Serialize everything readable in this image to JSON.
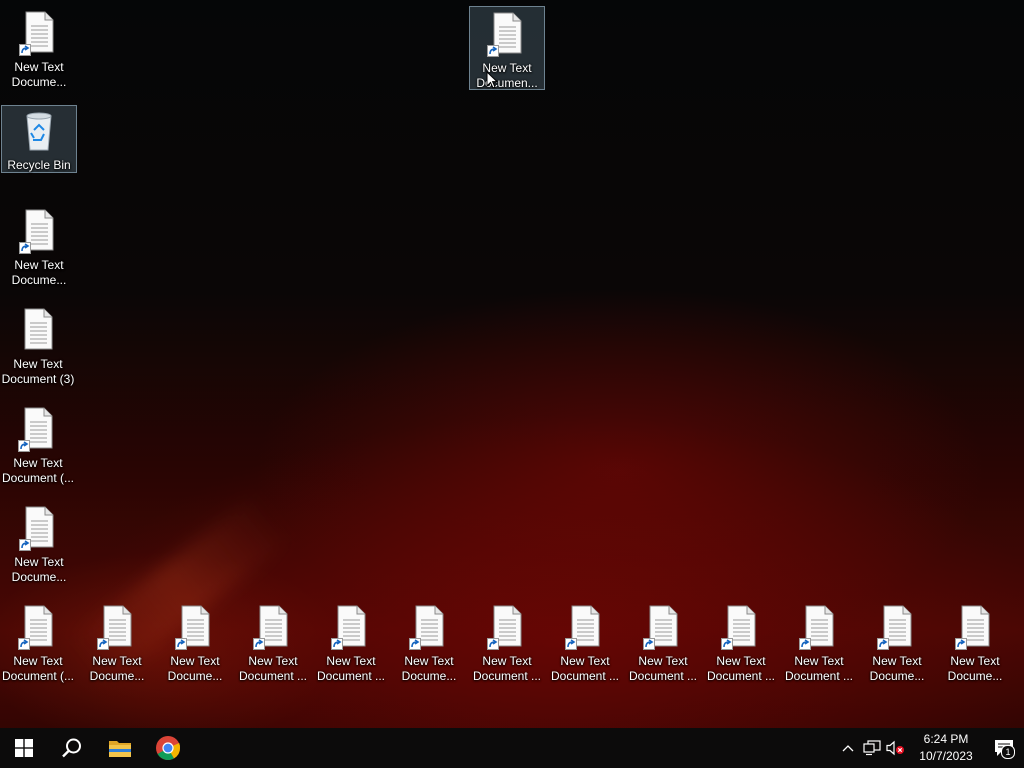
{
  "desktop": {
    "icons": [
      {
        "label": "New Text\nDocume...",
        "type": "text-document-shortcut",
        "selected": false
      },
      {
        "label": "Recycle Bin",
        "type": "recycle-bin",
        "selected": true
      },
      {
        "label": "New Text\nDocume...",
        "type": "text-document-shortcut",
        "selected": false
      },
      {
        "label": "New Text\nDocument (3)",
        "type": "text-document",
        "selected": false
      },
      {
        "label": "New Text\nDocument (...",
        "type": "text-document-shortcut",
        "selected": false
      },
      {
        "label": "New Text\nDocume...",
        "type": "text-document-shortcut",
        "selected": false
      },
      {
        "label": "New Text\nDocumen...",
        "type": "text-document-shortcut",
        "selected": true
      },
      {
        "label": "New Text\nDocument (...",
        "type": "text-document-shortcut",
        "selected": false
      },
      {
        "label": "New Text\nDocume...",
        "type": "text-document-shortcut",
        "selected": false
      },
      {
        "label": "New Text\nDocume...",
        "type": "text-document-shortcut",
        "selected": false
      },
      {
        "label": "New Text\nDocument ...",
        "type": "text-document-shortcut",
        "selected": false
      },
      {
        "label": "New Text\nDocument ...",
        "type": "text-document-shortcut",
        "selected": false
      },
      {
        "label": "New Text\nDocume...",
        "type": "text-document-shortcut",
        "selected": false
      },
      {
        "label": "New Text\nDocument ...",
        "type": "text-document-shortcut",
        "selected": false
      },
      {
        "label": "New Text\nDocument ...",
        "type": "text-document-shortcut",
        "selected": false
      },
      {
        "label": "New Text\nDocument ...",
        "type": "text-document-shortcut",
        "selected": false
      },
      {
        "label": "New Text\nDocument ...",
        "type": "text-document-shortcut",
        "selected": false
      },
      {
        "label": "New Text\nDocument ...",
        "type": "text-document-shortcut",
        "selected": false
      },
      {
        "label": "New Text\nDocume...",
        "type": "text-document-shortcut",
        "selected": false
      },
      {
        "label": "New Text\nDocume...",
        "type": "text-document-shortcut",
        "selected": false
      }
    ]
  },
  "taskbar": {
    "start": {
      "icon": "windows-logo-icon"
    },
    "search": {
      "icon": "search-icon"
    },
    "pinned": [
      {
        "name": "File Explorer",
        "icon": "folder-icon"
      },
      {
        "name": "Google Chrome",
        "icon": "chrome-icon"
      }
    ],
    "tray": {
      "overflow_icon": "chevron-up-icon",
      "network_icon": "network-icon",
      "volume_icon": "volume-muted-icon",
      "time": "6:24 PM",
      "date": "10/7/2023",
      "notifications_icon": "action-center-icon",
      "notification_count": "1"
    }
  },
  "colors": {
    "taskbar": "#0c0b0b",
    "accent_blue": "#1e90ff",
    "folder_yellow": "#f3c44a"
  }
}
